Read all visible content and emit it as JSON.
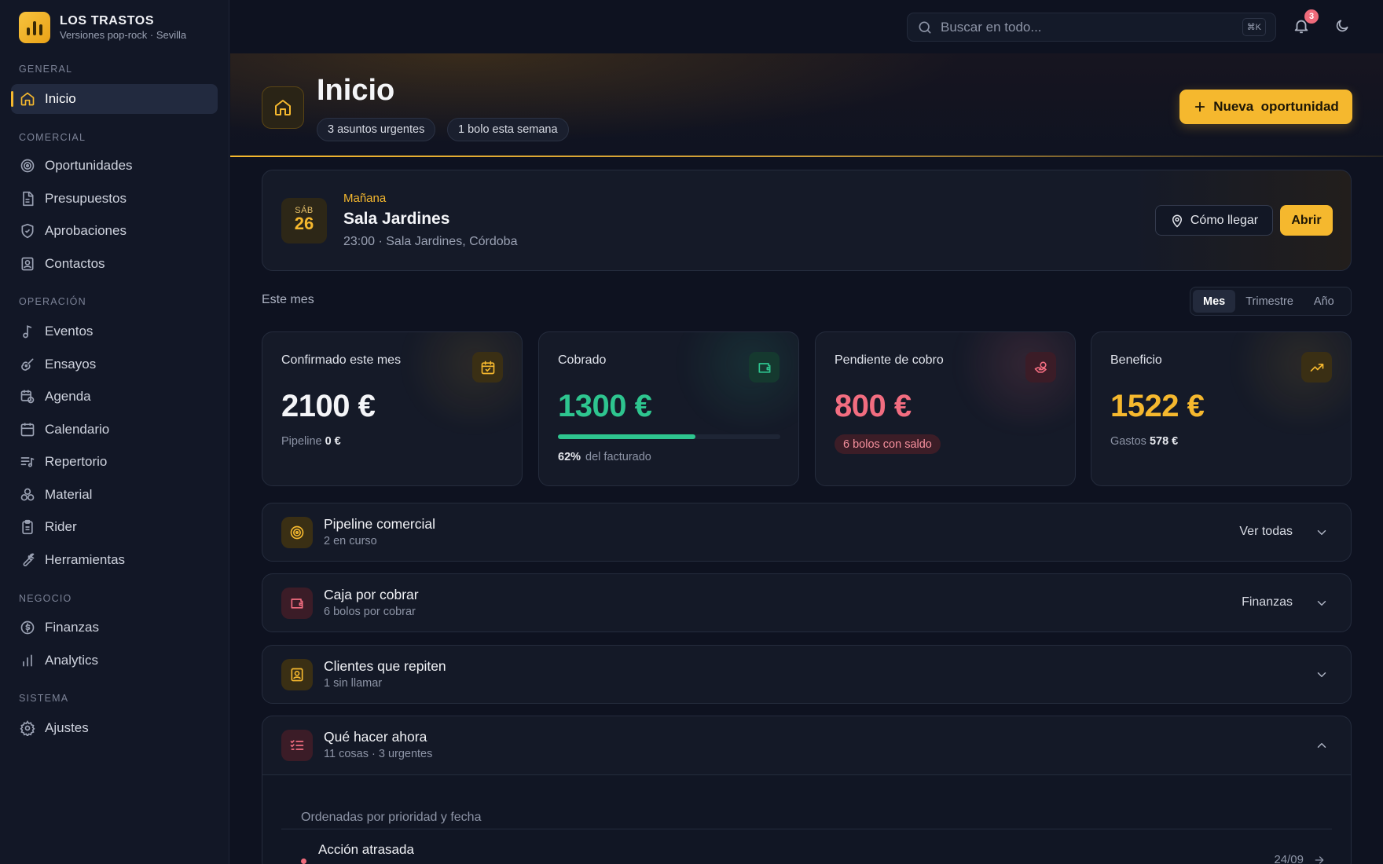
{
  "brand": {
    "name": "LOS TRASTOS",
    "subtitle": "Versiones pop-rock · Sevilla"
  },
  "sidebar": {
    "sections": [
      {
        "label": "GENERAL",
        "items": [
          {
            "label": "Inicio",
            "icon": "home-icon",
            "active": true
          }
        ]
      },
      {
        "label": "COMERCIAL",
        "items": [
          {
            "label": "Oportunidades",
            "icon": "target-icon"
          },
          {
            "label": "Presupuestos",
            "icon": "document-icon"
          },
          {
            "label": "Aprobaciones",
            "icon": "shield-check-icon"
          },
          {
            "label": "Contactos",
            "icon": "contact-card-icon"
          }
        ]
      },
      {
        "label": "OPERACIÓN",
        "items": [
          {
            "label": "Eventos",
            "icon": "music-note-icon"
          },
          {
            "label": "Ensayos",
            "icon": "guitar-icon"
          },
          {
            "label": "Agenda",
            "icon": "calendar-clock-icon"
          },
          {
            "label": "Calendario",
            "icon": "calendar-icon"
          },
          {
            "label": "Repertorio",
            "icon": "list-music-icon"
          },
          {
            "label": "Material",
            "icon": "speakers-icon"
          },
          {
            "label": "Rider",
            "icon": "clipboard-icon"
          },
          {
            "label": "Herramientas",
            "icon": "wrench-icon"
          }
        ]
      },
      {
        "label": "NEGOCIO",
        "items": [
          {
            "label": "Finanzas",
            "icon": "dollar-circle-icon"
          },
          {
            "label": "Analytics",
            "icon": "bar-chart-icon"
          }
        ]
      },
      {
        "label": "SISTEMA",
        "items": [
          {
            "label": "Ajustes",
            "icon": "gear-icon"
          }
        ]
      }
    ]
  },
  "topbar": {
    "search_placeholder": "Buscar en todo...",
    "shortcut": "⌘K",
    "notifications": "3"
  },
  "header": {
    "title": "Inicio",
    "chips": [
      "3 asuntos urgentes",
      "1 bolo esta semana"
    ],
    "new_button": "Nueva  oportunidad"
  },
  "next_event": {
    "when": "Mañana",
    "dow": "SÁB",
    "day": "26",
    "name": "Sala Jardines",
    "detail": "23:00 · Sala Jardines, Córdoba",
    "directions_label": "Cómo llegar",
    "open_label": "Abrir"
  },
  "period": {
    "label": "Este mes",
    "options": [
      "Mes",
      "Trimestre",
      "Año"
    ],
    "selected": "Mes"
  },
  "stats": [
    {
      "label": "Confirmado este mes",
      "value": "2100 €",
      "foot_label": "Pipeline",
      "foot_value": "0 €",
      "color": "#f4f5f8",
      "accent": "#f5b82e"
    },
    {
      "label": "Cobrado",
      "value": "1300 €",
      "progress": 0.62,
      "foot_value": "62%",
      "foot_label": "del facturado",
      "color": "#2ec58f",
      "accent": "#2ec58f"
    },
    {
      "label": "Pendiente de cobro",
      "value": "800 €",
      "pill": "6 bolos con saldo",
      "color": "#f26d80",
      "accent": "#f26d80"
    },
    {
      "label": "Beneficio",
      "value": "1522 €",
      "foot_label": "Gastos",
      "foot_value": "578 €",
      "color": "#f5b82e",
      "accent": "#f5b82e"
    }
  ],
  "sections": [
    {
      "title": "Pipeline comercial",
      "subtitle": "2 en curso",
      "action": "Ver todas",
      "icon": "target-icon",
      "accent": "#f5b82e"
    },
    {
      "title": "Caja por cobrar",
      "subtitle": "6 bolos por cobrar",
      "action": "Finanzas",
      "icon": "wallet-icon",
      "accent": "#f26d80"
    },
    {
      "title": "Clientes que repiten",
      "subtitle": "1 sin llamar",
      "action": "",
      "icon": "contact-card-icon",
      "accent": "#f5b82e"
    }
  ],
  "todo": {
    "title": "Qué hacer ahora",
    "subtitle": "11 cosas · 3 urgentes",
    "note": "Ordenadas por prioridad y fecha",
    "first_item": "Acción atrasada",
    "first_date": "24/09"
  }
}
